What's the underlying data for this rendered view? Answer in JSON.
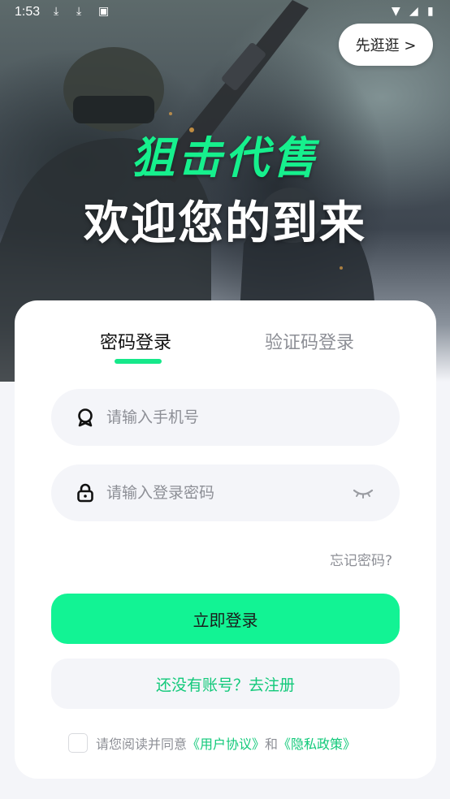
{
  "status_bar": {
    "time": "1:53"
  },
  "header": {
    "guest_button": "先逛逛 >",
    "title_line1": "狙击代售",
    "title_line2": "欢迎您的到来"
  },
  "tabs": {
    "password_login": "密码登录",
    "code_login": "验证码登录"
  },
  "form": {
    "phone_placeholder": "请输入手机号",
    "password_placeholder": "请输入登录密码",
    "forgot_password": "忘记密码?",
    "login_button": "立即登录",
    "register_button": "还没有账号？去注册"
  },
  "agreement": {
    "prefix": "请您阅读并同意",
    "user_agreement": "《用户协议》",
    "and": "和",
    "privacy_policy": "《隐私政策》"
  },
  "colors": {
    "accent": "#12f394",
    "link": "#12c97a",
    "title_green": "#16f08d"
  },
  "icons": {
    "phone": "badge-icon",
    "password": "lock-icon",
    "visibility": "eye-closed-icon"
  }
}
